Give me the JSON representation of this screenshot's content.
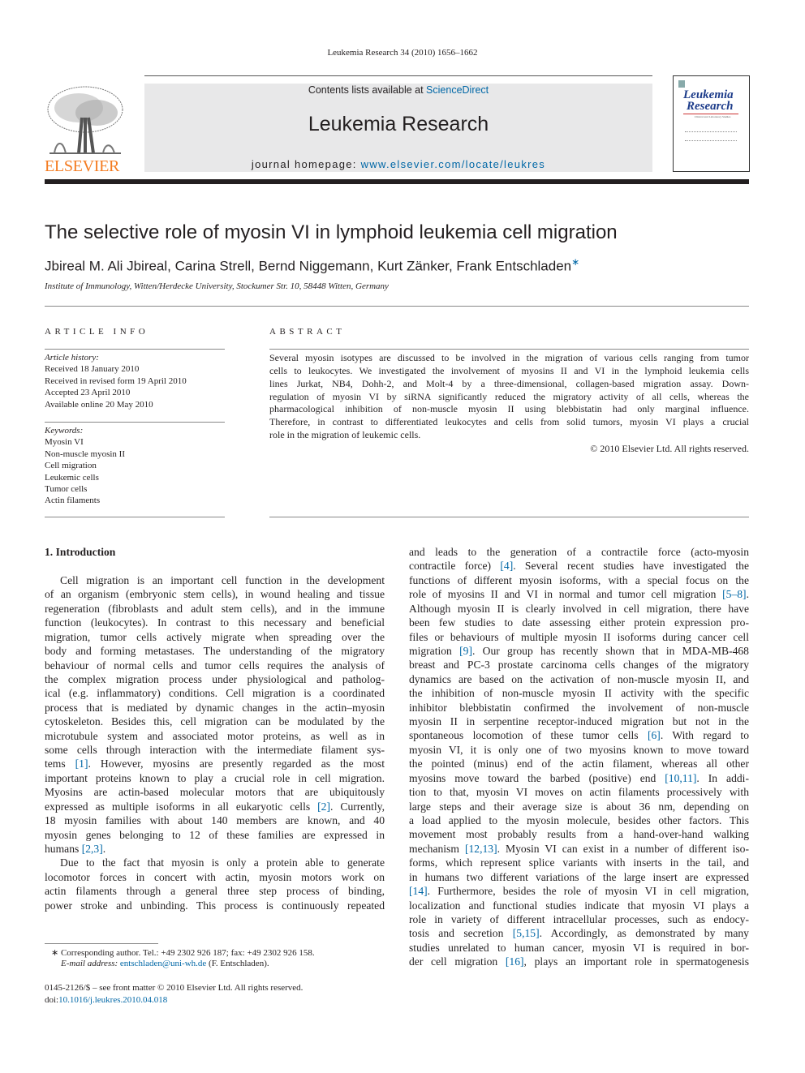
{
  "running_head": "Leukemia Research 34 (2010) 1656–1662",
  "banner": {
    "contents_prefix": "Contents lists available at ",
    "sciencedirect": "ScienceDirect",
    "journal_title": "Leukemia Research",
    "homepage_prefix": "journal homepage: ",
    "homepage_url": "www.elsevier.com/locate/leukres"
  },
  "publisher_logo": "ELSEVIER",
  "cover": {
    "title_line1": "Leukemia",
    "title_line2": "Research",
    "subtitle": "Clinical and Laboratory Studies"
  },
  "colors": {
    "link": "#0067a6",
    "elsevier_orange": "#f47b20",
    "banner_bg": "#e8e8e9"
  },
  "article": {
    "title": "The selective role of myosin VI in lymphoid leukemia cell migration",
    "authors": "Jbireal M. Ali Jbireal, Carina Strell, Bernd Niggemann, Kurt Zänker, Frank Entschladen",
    "author_mark": "∗",
    "affiliation": "Institute of Immunology, Witten/Herdecke University, Stockumer Str. 10, 58448 Witten, Germany"
  },
  "article_info": {
    "heading": "ARTICLE INFO",
    "history_label": "Article history:",
    "history": [
      "Received 18 January 2010",
      "Received in revised form 19 April 2010",
      "Accepted 23 April 2010",
      "Available online 20 May 2010"
    ],
    "keywords_label": "Keywords:",
    "keywords": [
      "Myosin VI",
      "Non-muscle myosin II",
      "Cell migration",
      "Leukemic cells",
      "Tumor cells",
      "Actin filaments"
    ]
  },
  "abstract": {
    "heading": "ABSTRACT",
    "lines": [
      "Several myosin isotypes are discussed to be involved in the migration of various cells ranging from tumor",
      "cells to leukocytes. We investigated the involvement of myosins II and VI in the lymphoid leukemia cells",
      "lines Jurkat, NB4, Dohh-2, and Molt-4 by a three-dimensional, collagen-based migration assay. Down-",
      "regulation of myosin VI by siRNA significantly reduced the migratory activity of all cells, whereas the",
      "pharmacological inhibition of non-muscle myosin II using blebbistatin had only marginal influence.",
      "Therefore, in contrast to differentiated leukocytes and cells from solid tumors, myosin VI plays a crucial",
      "role in the migration of leukemic cells."
    ],
    "copyright": "© 2010 Elsevier Ltd. All rights reserved."
  },
  "section1": {
    "heading": "1.  Introduction",
    "left_lines": [
      "Cell migration is an important cell function in the development",
      "of an organism (embryonic stem cells), in wound healing and tissue",
      "regeneration (fibroblasts and adult stem cells), and in the immune",
      "function (leukocytes). In contrast to this necessary and beneficial",
      "migration, tumor cells actively migrate when spreading over the",
      "body and forming metastases. The understanding of the migratory",
      "behaviour of normal cells and tumor cells requires the analysis of",
      "the complex migration process under physiological and patholog-",
      "ical (e.g. inflammatory) conditions. Cell migration is a coordinated",
      "process that is mediated by dynamic changes in the actin–myosin",
      "cytoskeleton. Besides this, cell migration can be modulated by the",
      "microtubule system and associated motor proteins, as well as in",
      "some cells through interaction with the intermediate filament sys-",
      "tems [1]. However, myosins are presently regarded as the most",
      "important proteins known to play a crucial role in cell migration.",
      "Myosins are actin-based molecular motors that are ubiquitously",
      "expressed as multiple isoforms in all eukaryotic cells [2]. Currently,",
      "18 myosin families with about 140 members are known, and 40",
      "myosin genes belonging to 12 of these families are expressed in",
      "humans [2,3].",
      "Due to the fact that myosin is only a protein able to generate",
      "locomotor forces in concert with actin, myosin motors work on",
      "actin filaments through a general three step process of binding,",
      "power stroke and unbinding. This process is continuously repeated"
    ],
    "right_lines": [
      "and leads to the generation of a contractile force (acto-myosin",
      "contractile force) [4]. Several recent studies have investigated the",
      "functions of different myosin isoforms, with a special focus on the",
      "role of myosins II and VI in normal and tumor cell migration [5–8].",
      "Although myosin II is clearly involved in cell migration, there have",
      "been few studies to date assessing either protein expression pro-",
      "files or behaviours of multiple myosin II isoforms during cancer cell",
      "migration [9]. Our group has recently shown that in MDA-MB-468",
      "breast and PC-3 prostate carcinoma cells changes of the migratory",
      "dynamics are based on the activation of non-muscle myosin II, and",
      "the inhibition of non-muscle myosin II activity with the specific",
      "inhibitor blebbistatin confirmed the involvement of non-muscle",
      "myosin II in serpentine receptor-induced migration but not in the",
      "spontaneous locomotion of these tumor cells [6]. With regard to",
      "myosin VI, it is only one of two myosins known to move toward",
      "the pointed (minus) end of the actin filament, whereas all other",
      "myosins move toward the barbed (positive) end [10,11]. In addi-",
      "tion to that, myosin VI moves on actin filaments processively with",
      "large steps and their average size is about 36 nm, depending on",
      "a load applied to the myosin molecule, besides other factors. This",
      "movement most probably results from a hand-over-hand walking",
      "mechanism [12,13]. Myosin VI can exist in a number of different iso-",
      "forms, which represent splice variants with inserts in the tail, and",
      "in humans two different variations of the large insert are expressed",
      "[14]. Furthermore, besides the role of myosin VI in cell migration,",
      "localization and functional studies indicate that myosin VI plays a",
      "role in variety of different intracellular processes, such as endocy-",
      "tosis and secretion [5,15]. Accordingly, as demonstrated by many",
      "studies unrelated to human cancer, myosin VI is required in bor-",
      "der cell migration [16], plays an important role in spermatogenesis"
    ]
  },
  "footnote": {
    "corresponding": "∗  Corresponding author. Tel.: +49 2302 926 187; fax: +49 2302 926 158.",
    "email_label": "E-mail address: ",
    "email": "entschladen@uni-wh.de",
    "email_suffix": " (F. Entschladen)."
  },
  "front_matter": {
    "issn": "0145-2126/$ – see front matter © 2010 Elsevier Ltd. All rights reserved.",
    "doi_prefix": "doi:",
    "doi": "10.1016/j.leukres.2010.04.018"
  }
}
